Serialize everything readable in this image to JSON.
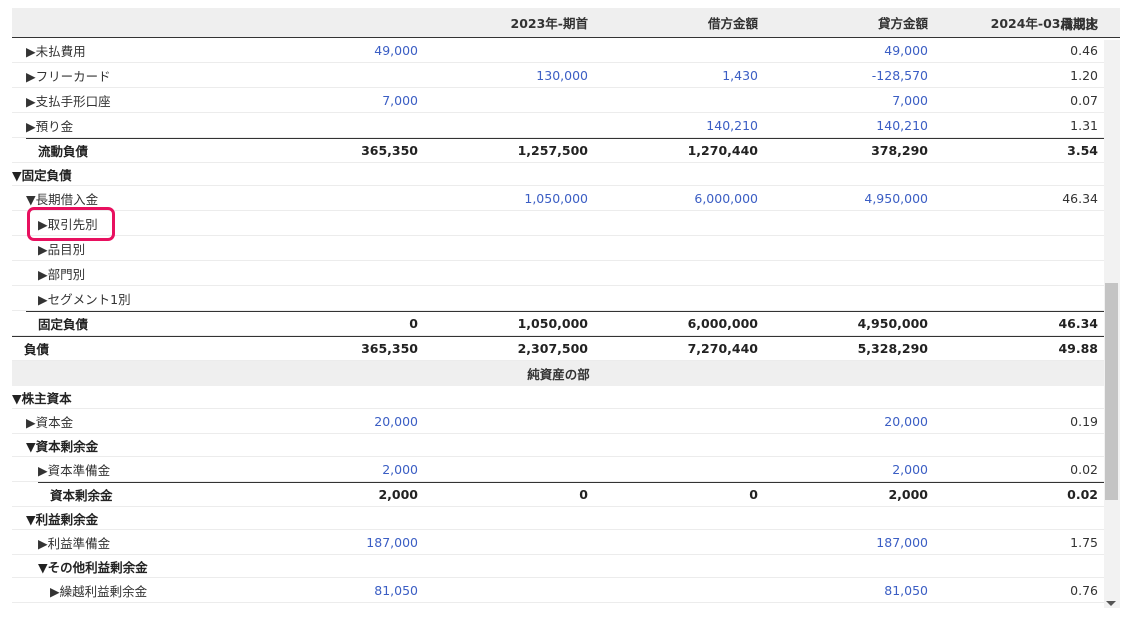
{
  "header": {
    "col_name": "",
    "col_opening": "2023年-期首",
    "col_debit": "借方金額",
    "col_credit": "貸方金額",
    "col_closing": "2024年-03月期末",
    "col_ratio": "構成比"
  },
  "rows": {
    "r0": {
      "label": "▶未払費用",
      "opening": "49,000",
      "debit": "",
      "credit": "",
      "closing": "49,000",
      "ratio": "0.46"
    },
    "r1": {
      "label": "▶フリーカード",
      "opening": "",
      "debit": "130,000",
      "credit": "1,430",
      "closing": "-128,570",
      "ratio": "1.20"
    },
    "r2": {
      "label": "▶支払手形口座",
      "opening": "7,000",
      "debit": "",
      "credit": "",
      "closing": "7,000",
      "ratio": "0.07"
    },
    "r3": {
      "label": "▶預り金",
      "opening": "",
      "debit": "",
      "credit": "140,210",
      "closing": "140,210",
      "ratio": "1.31"
    },
    "r4": {
      "label": "流動負債",
      "opening": "365,350",
      "debit": "1,257,500",
      "credit": "1,270,440",
      "closing": "378,290",
      "ratio": "3.54"
    },
    "r5": {
      "label": "▼固定負債"
    },
    "r6": {
      "label": "▼長期借入金",
      "opening": "",
      "debit": "1,050,000",
      "credit": "6,000,000",
      "closing": "4,950,000",
      "ratio": "46.34"
    },
    "r7": {
      "label": "▶取引先別"
    },
    "r8": {
      "label": "▶品目別"
    },
    "r9": {
      "label": "▶部門別"
    },
    "r10": {
      "label": "▶セグメント1別"
    },
    "r11": {
      "label": "固定負債",
      "opening": "0",
      "debit": "1,050,000",
      "credit": "6,000,000",
      "closing": "4,950,000",
      "ratio": "46.34"
    },
    "r12": {
      "label": "負債",
      "opening": "365,350",
      "debit": "2,307,500",
      "credit": "7,270,440",
      "closing": "5,328,290",
      "ratio": "49.88"
    },
    "r13": {
      "label": "純資産の部"
    },
    "r14": {
      "label": "▼株主資本"
    },
    "r15": {
      "label": "▶資本金",
      "opening": "20,000",
      "debit": "",
      "credit": "",
      "closing": "20,000",
      "ratio": "0.19"
    },
    "r16": {
      "label": "▼資本剰余金"
    },
    "r17": {
      "label": "▶資本準備金",
      "opening": "2,000",
      "debit": "",
      "credit": "",
      "closing": "2,000",
      "ratio": "0.02"
    },
    "r18": {
      "label": "資本剰余金",
      "opening": "2,000",
      "debit": "0",
      "credit": "0",
      "closing": "2,000",
      "ratio": "0.02"
    },
    "r19": {
      "label": "▼利益剰余金"
    },
    "r20": {
      "label": "▶利益準備金",
      "opening": "187,000",
      "debit": "",
      "credit": "",
      "closing": "187,000",
      "ratio": "1.75"
    },
    "r21": {
      "label": "▼その他利益剰余金"
    },
    "r22": {
      "label": "▶繰越利益剰余金",
      "opening": "81,050",
      "debit": "",
      "credit": "",
      "closing": "81,050",
      "ratio": "0.76"
    }
  },
  "colors": {
    "link_blue": "#3b5ec4",
    "highlight": "#e8105f",
    "header_bg": "#efefef"
  }
}
